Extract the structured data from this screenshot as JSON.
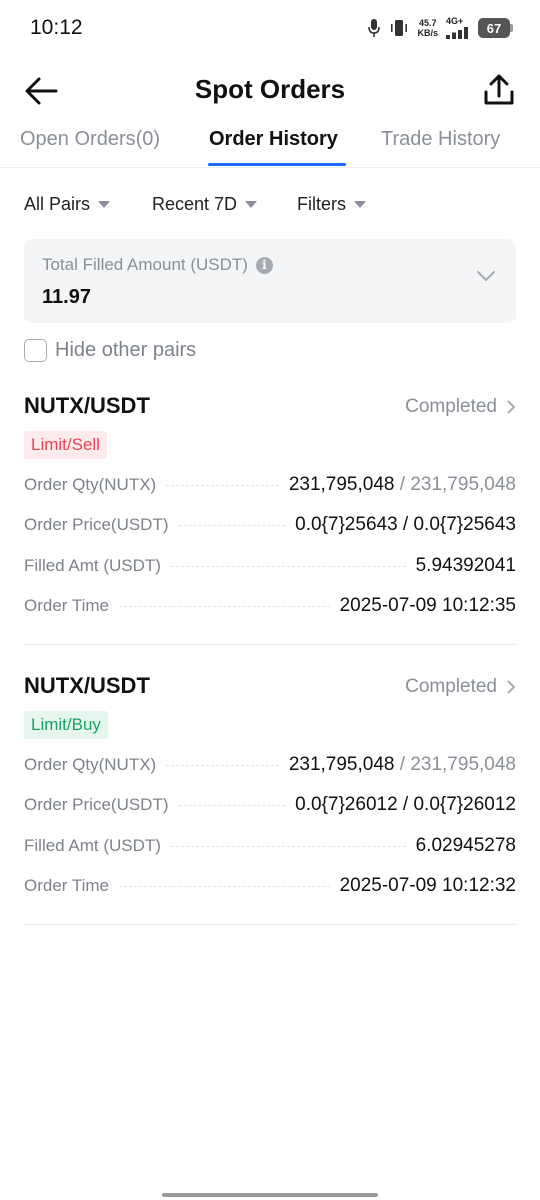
{
  "status_bar": {
    "time": "10:12",
    "speed_value": "45.7",
    "speed_unit": "KB/s",
    "network": "4G+",
    "battery": "67"
  },
  "header": {
    "title": "Spot Orders",
    "back_icon": "arrow-left-icon",
    "export_icon": "share-upload-icon"
  },
  "tabs": [
    {
      "label": "Open Orders(0)",
      "active": false
    },
    {
      "label": "Order History",
      "active": true
    },
    {
      "label": "Trade History",
      "active": false
    }
  ],
  "filters": {
    "pairs": "All Pairs",
    "period": "Recent 7D",
    "filters": "Filters"
  },
  "summary": {
    "label": "Total Filled Amount (USDT)",
    "value": "11.97"
  },
  "hide_other_pairs": {
    "label": "Hide other pairs",
    "checked": false
  },
  "orders": [
    {
      "pair": "NUTX/USDT",
      "status": "Completed",
      "side": "Limit/Sell",
      "qty_label": "Order Qty(NUTX)",
      "qty_filled": "231,795,048",
      "qty_total": "231,795,048",
      "price_label": "Order Price(USDT)",
      "price_value": "0.0{7}25643 / 0.0{7}25643",
      "amt_label": "Filled Amt (USDT)",
      "amt_value": "5.94392041",
      "time_label": "Order Time",
      "time_value": "2025-07-09 10:12:35"
    },
    {
      "pair": "NUTX/USDT",
      "status": "Completed",
      "side": "Limit/Buy",
      "qty_label": "Order Qty(NUTX)",
      "qty_filled": "231,795,048",
      "qty_total": "231,795,048",
      "price_label": "Order Price(USDT)",
      "price_value": "0.0{7}26012 / 0.0{7}26012",
      "amt_label": "Filled Amt (USDT)",
      "amt_value": "6.02945278",
      "time_label": "Order Time",
      "time_value": "2025-07-09 10:12:32"
    }
  ],
  "colors": {
    "accent": "#1a6cff",
    "sell": "#e8455a",
    "buy": "#16a464",
    "muted_text": "#8a8f99"
  }
}
